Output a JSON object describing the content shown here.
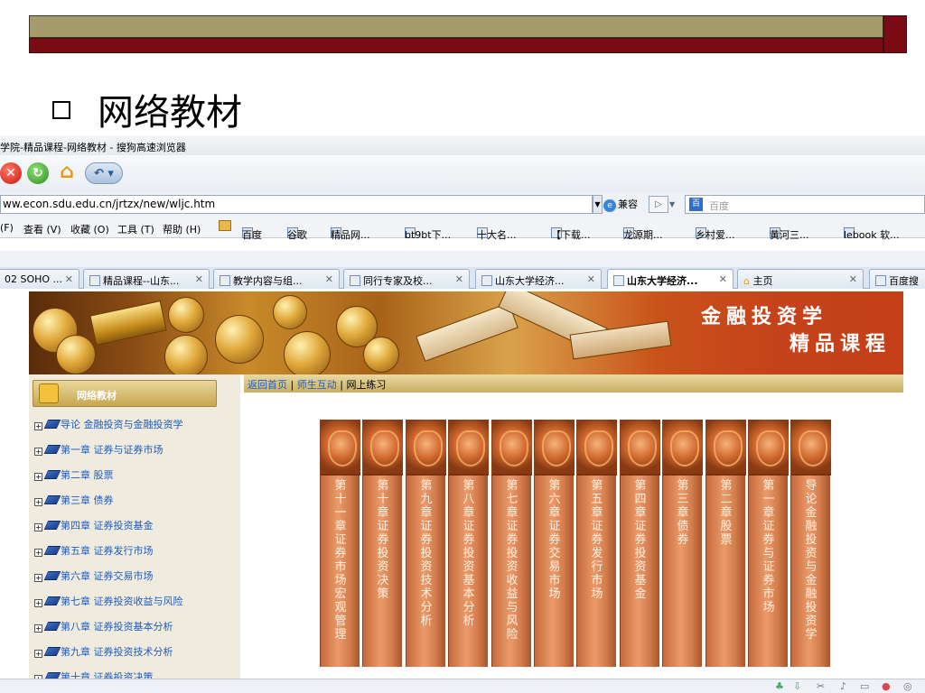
{
  "slide": {
    "title": "网络教材"
  },
  "browser": {
    "window_title": "学院-精品课程-网络教材 - 搜狗高速浏览器",
    "address": "ww.econ.sdu.edu.cn/jrtzx/new/wljc.htm",
    "compat_label": "兼容",
    "search_placeholder": "百度",
    "menu": [
      "(F)",
      "查看 (V)",
      "收藏 (O)",
      "工具 (T)",
      "帮助 (H)"
    ],
    "favorites": [
      "百度",
      "谷歌",
      "精品网...",
      "bt9bt下...",
      "十大名...",
      "【下载...",
      "龙源期...",
      "乡村爱...",
      "黄河三...",
      "lebook 软..."
    ],
    "tabs": [
      {
        "label": "02 SOHO ...",
        "active": false
      },
      {
        "label": "精品课程--山东...",
        "active": false
      },
      {
        "label": "教学内容与组...",
        "active": false
      },
      {
        "label": "同行专家及校...",
        "active": false
      },
      {
        "label": "山东大学经济...",
        "active": false
      },
      {
        "label": "山东大学经济...",
        "active": true
      },
      {
        "label": "主页",
        "active": false
      },
      {
        "label": "百度搜",
        "active": false
      }
    ]
  },
  "site": {
    "banner_title": "金融投资学",
    "banner_subtitle": "精品课程",
    "sidebar_title": "网络教材",
    "breadcrumb": {
      "home": "返回首页",
      "sep1": "|",
      "interact": "师生互动",
      "sep2": "|",
      "current": "网上练习"
    },
    "chapters": [
      "导论  金融投资与金融投资学",
      "第一章  证券与证券市场",
      "第二章  股票",
      "第三章  债券",
      "第四章  证券投资基金",
      "第五章  证券发行市场",
      "第六章  证券交易市场",
      "第七章  证券投资收益与风险",
      "第八章  证券投资基本分析",
      "第九章  证券投资技术分析",
      "第十章  证券投资决策"
    ],
    "book_spines": [
      "第十一章 证券市场宏观管理",
      "第十章 证券投资决策",
      "第九章 证券投资技术分析",
      "第八章 证券投资基本分析",
      "第七章 证券投资收益与风险",
      "第六章 证券交易市场",
      "第五章 证券发行市场",
      "第四章 证券投资基金",
      "第三章 债券",
      "第二章 股票",
      "第一章 证券与证券市场",
      "导论 金融投资与金融投资学"
    ]
  },
  "colors": {
    "band_olive": "#a59b6b",
    "band_red": "#7a0a14",
    "link_blue": "#1f5bbf",
    "book_orange": "#d27c4c"
  }
}
